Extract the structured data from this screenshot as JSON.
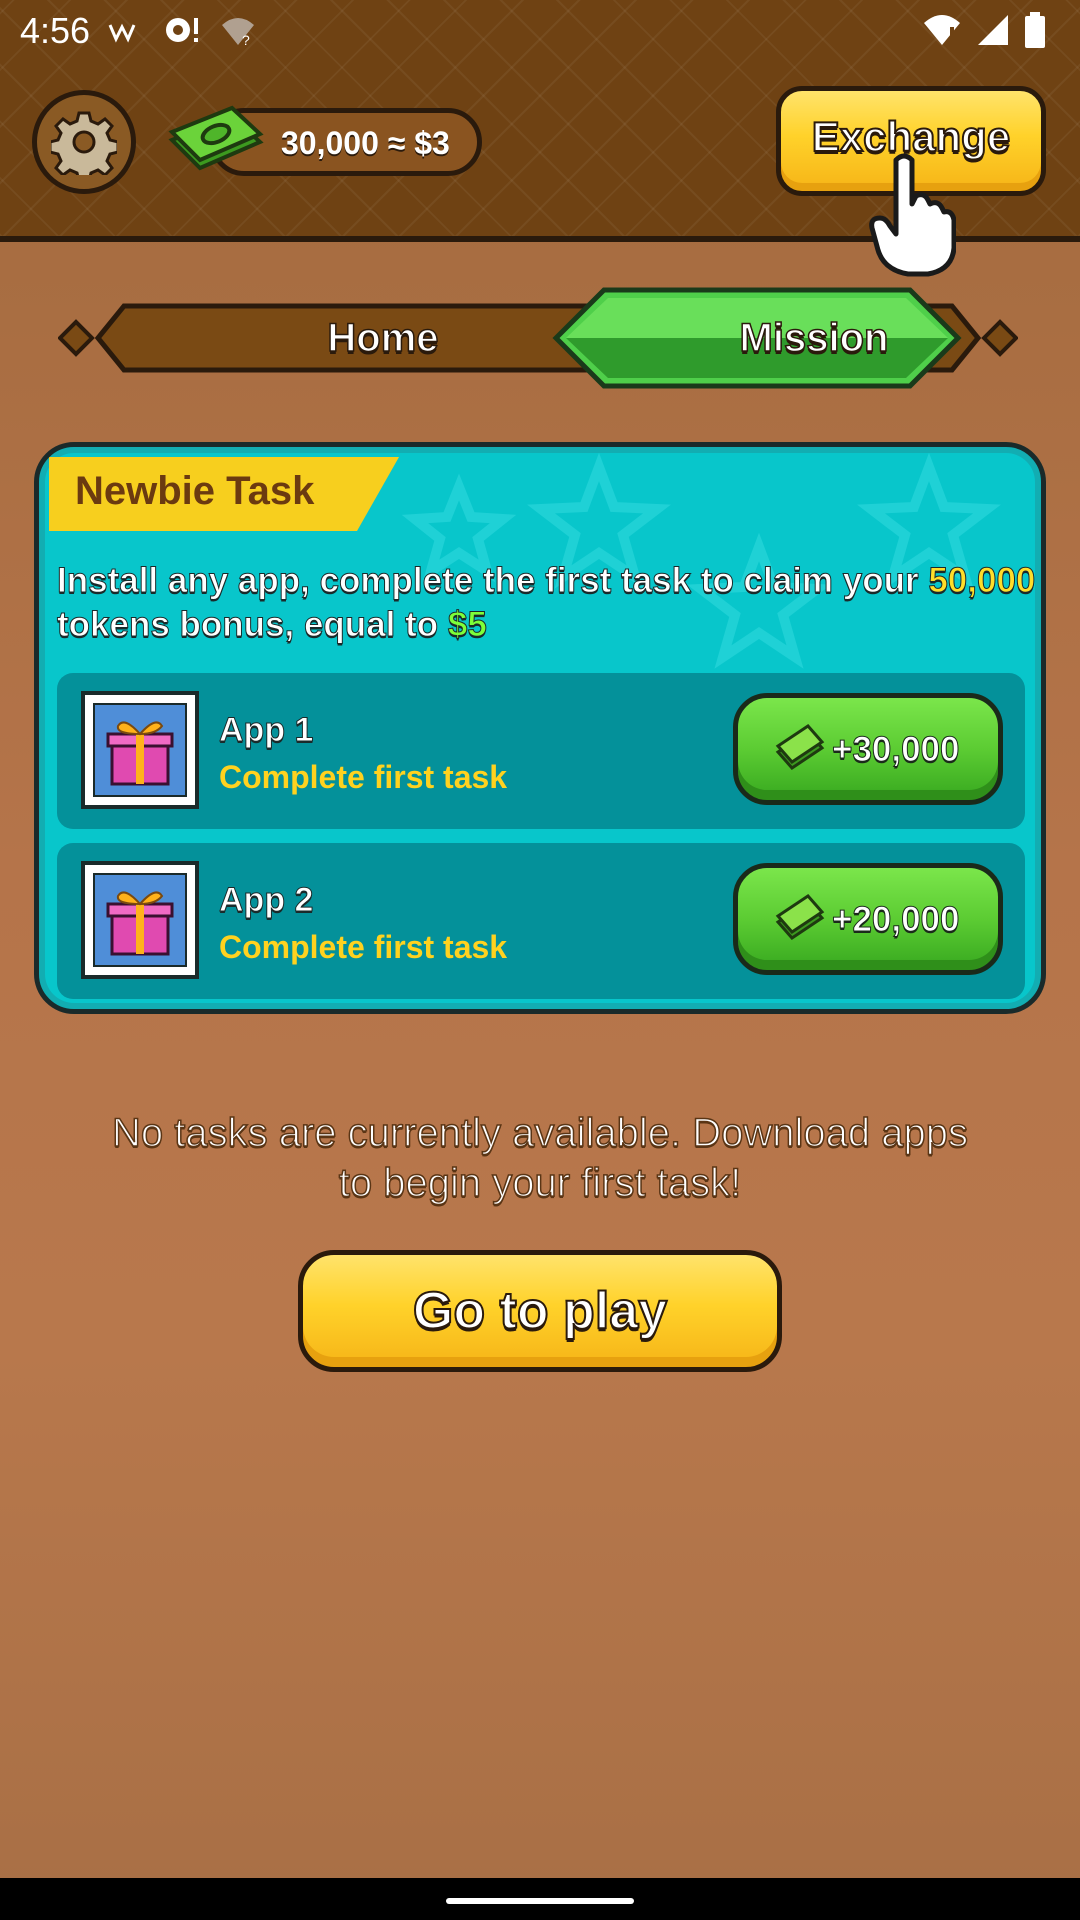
{
  "status_bar": {
    "time": "4:56"
  },
  "header": {
    "balance": "30,000 ≈ $3",
    "exchange_label": "Exchange"
  },
  "tabs": [
    {
      "label": "Home",
      "active": false
    },
    {
      "label": "Mission",
      "active": true
    }
  ],
  "newbie_task": {
    "title": "Newbie Task",
    "desc_part1": "Install any app, complete the first task to claim your ",
    "desc_tokens": "50,000",
    "desc_part2": " tokens bonus, equal to ",
    "desc_usd": "$5",
    "tasks": [
      {
        "name": "App 1",
        "subtitle": "Complete first task",
        "reward": "+30,000"
      },
      {
        "name": "App 2",
        "subtitle": "Complete first task",
        "reward": "+20,000"
      }
    ]
  },
  "empty_message": "No tasks are currently available. Download apps to begin your first task!",
  "play_button": "Go to play",
  "colors": {
    "header_bg": "#6f4213",
    "card_bg": "#08c6cb",
    "accent_yellow": "#ffd22a",
    "accent_green": "#5ccc33"
  }
}
